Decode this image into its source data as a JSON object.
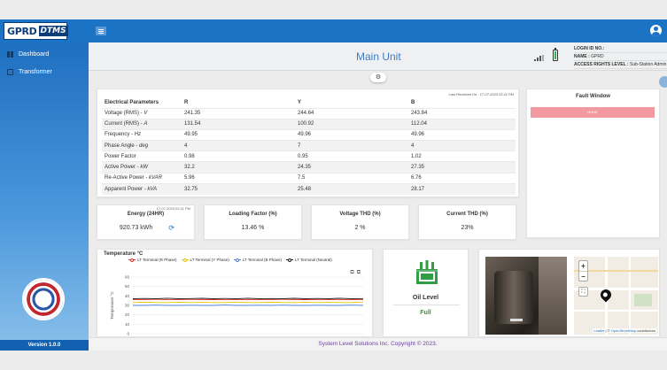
{
  "brand": {
    "logo_part1": "GPRD",
    "logo_part2": "DTMS"
  },
  "sidebar": {
    "items": [
      {
        "label": "Dashboard",
        "icon": "dashboard-icon"
      },
      {
        "label": "Transformer",
        "icon": "transformer-icon"
      }
    ],
    "version": "Version 1.0.0"
  },
  "header": {
    "title": "Main Unit",
    "login_id_label": "LOGIN ID NO.:",
    "login_id_value": "",
    "name_label": "NAME :",
    "name_value": "GPRD",
    "access_label": "ACCESS RIGHTS LEVEL :",
    "access_value": "Sub-Station Admin"
  },
  "electrical": {
    "last_received": "Last Received On : 17-07-2023 02:11 PM",
    "headers": [
      "Electrical Parameters",
      "R",
      "Y",
      "B"
    ],
    "rows": [
      {
        "param": "Voltage (RMS) - ",
        "unit": "V",
        "r": "241.35",
        "y": "244.64",
        "b": "243.84"
      },
      {
        "param": "Current (RMS) - ",
        "unit": "A",
        "r": "131.54",
        "y": "100.92",
        "b": "112.04"
      },
      {
        "param": "Frequency - ",
        "unit": "Hz",
        "r": "49.95",
        "y": "49.96",
        "b": "49.96"
      },
      {
        "param": "Phase Angle - ",
        "unit": "deg",
        "r": "4",
        "y": "7",
        "b": "4"
      },
      {
        "param": "Power Factor",
        "unit": "",
        "r": "0.98",
        "y": "0.95",
        "b": "1.02"
      },
      {
        "param": "Active Power - ",
        "unit": "kW",
        "r": "32.2",
        "y": "24.35",
        "b": "27.35"
      },
      {
        "param": "Re-Active Power - ",
        "unit": "kVAR",
        "r": "5.96",
        "y": "7.5",
        "b": "6.76"
      },
      {
        "param": "Apparent Power - ",
        "unit": "kVA",
        "r": "32.75",
        "y": "25.48",
        "b": "28.17"
      }
    ]
  },
  "fault": {
    "title": "Fault Window",
    "alert": "NONE",
    "alert_color": "#f29aa0"
  },
  "metrics": {
    "energy": {
      "timestamp": "17-07-2023 02:11 PM",
      "label": "Energy (24HR)",
      "value": "920.73 kWh"
    },
    "loading": {
      "label": "Loading Factor (%)",
      "value": "13.46 %"
    },
    "voltage_thd": {
      "label": "Voltage THD (%)",
      "value": "2 %"
    },
    "current_thd": {
      "label": "Current THD (%)",
      "value": "23%"
    }
  },
  "temperature": {
    "title": "Temperature °C",
    "legend": [
      {
        "name": "LT Terminal (R Phase)",
        "color": "#e03131"
      },
      {
        "name": "LT Terminal (Y Phase)",
        "color": "#e6c200"
      },
      {
        "name": "LT Terminal (B Phase)",
        "color": "#4a7fd4"
      },
      {
        "name": "LT Terminal (Neutral)",
        "color": "#222222"
      }
    ]
  },
  "chart_data": {
    "type": "line",
    "ylabel": "Temperature °C",
    "ylim": [
      0,
      60
    ],
    "yticks": [
      0,
      10,
      20,
      30,
      40,
      50,
      60
    ],
    "grid": true,
    "series": [
      {
        "name": "LT Terminal (R Phase)",
        "color": "#e03131",
        "level": 36,
        "values": [
          36,
          36,
          36.5,
          36,
          36,
          36.4,
          36,
          36.2,
          36,
          36,
          36.3,
          36,
          36,
          36.5,
          36,
          36.1,
          36,
          36,
          36.3,
          36,
          36
        ]
      },
      {
        "name": "LT Terminal (Y Phase)",
        "color": "#e6c200",
        "level": 33,
        "values": [
          33,
          33.5,
          33,
          33,
          33.4,
          33,
          33.2,
          33,
          33,
          33.5,
          33,
          33,
          33.3,
          33,
          33,
          33.4,
          33,
          33.2,
          33,
          33,
          33.5
        ]
      },
      {
        "name": "LT Terminal (B Phase)",
        "color": "#4a7fd4",
        "level": 30,
        "values": [
          30,
          30,
          30.3,
          30,
          30,
          30.2,
          30,
          30,
          30.4,
          30,
          30,
          30.2,
          30,
          30.3,
          30,
          30,
          30.2,
          30,
          30,
          30.3,
          30
        ]
      },
      {
        "name": "LT Terminal (Neutral)",
        "color": "#222222",
        "level": 37,
        "values": [
          37,
          37.3,
          37,
          37.6,
          37,
          37.2,
          37.5,
          37,
          37.3,
          37,
          37.6,
          37,
          37.2,
          37,
          37.5,
          37,
          37.3,
          37,
          37.6,
          37,
          37.2
        ]
      }
    ]
  },
  "oil": {
    "label": "Oil Level",
    "value": "Full",
    "value_color": "#2b9a2b"
  },
  "map": {
    "zoom_in": "+",
    "zoom_out": "−",
    "attribution_prefix": "Leaflet",
    "attribution_sep": " | © ",
    "attribution_link": "OpenStreetMap",
    "attribution_suffix": " contributors"
  },
  "footer": {
    "text": "System Level Solutions Inc. Copyright © 2023."
  }
}
